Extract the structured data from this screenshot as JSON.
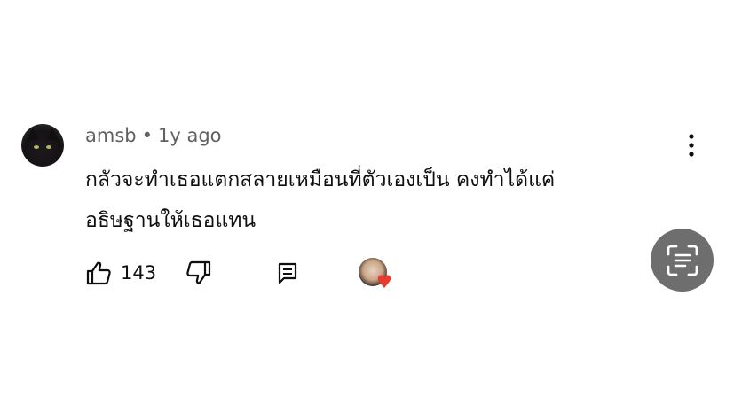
{
  "comment": {
    "author": "amsb",
    "separator": "•",
    "time": "1y ago",
    "lines": [
      "กลัวจะทำเธอแตกสลายเหมือนที่ตัวเองเป็น คงทำได้แค่",
      "อธิษฐานให้เธอแทน"
    ]
  },
  "actions": {
    "like_count": "143",
    "icons": [
      "thumbs-up-icon",
      "thumbs-down-icon",
      "reply-icon",
      "creator-heart-icon"
    ]
  },
  "overlay": {
    "icon": "text-scan-icon"
  },
  "colors": {
    "meta_text": "#606060",
    "heart": "#e63b2e",
    "lens_button": "#6e6e6e"
  }
}
